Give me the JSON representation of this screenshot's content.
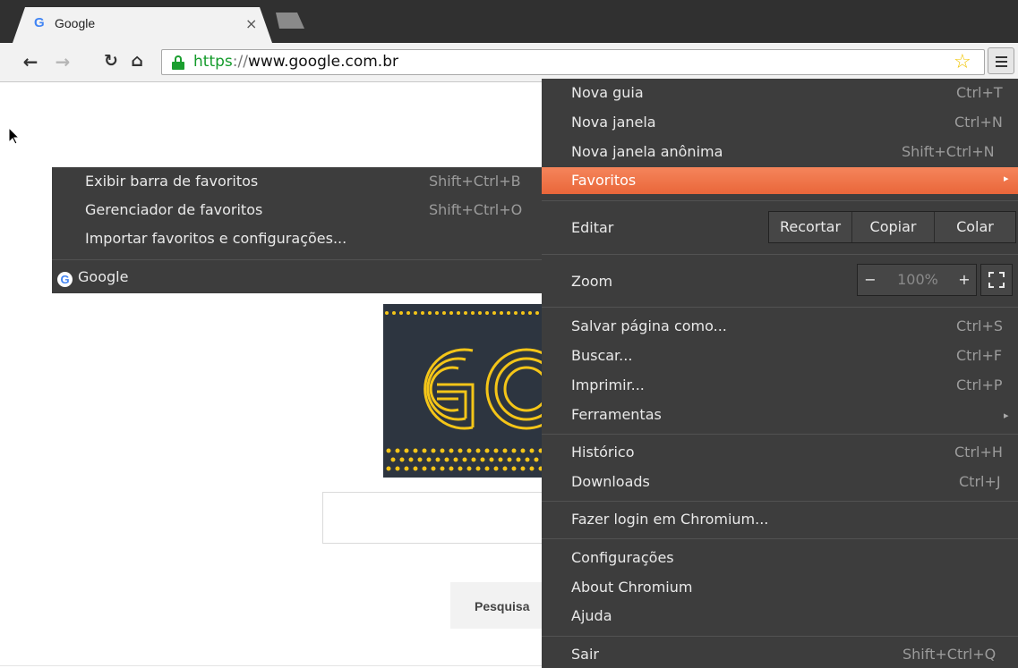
{
  "browser": {
    "tab": {
      "title": "Google",
      "close": "×"
    },
    "url": {
      "scheme": "https",
      "separator": "://",
      "host": "www.google.com.br"
    }
  },
  "page": {
    "search_button": "Pesquisa"
  },
  "main_menu": {
    "items": [
      {
        "label": "Nova guia",
        "shortcut": "Ctrl+T"
      },
      {
        "label": "Nova janela",
        "shortcut": "Ctrl+N"
      },
      {
        "label": "Nova janela anônima",
        "shortcut": "Shift+Ctrl+N"
      }
    ],
    "favoritos": {
      "label": "Favoritos",
      "arrow": "▸"
    },
    "edit": {
      "label": "Editar",
      "cut": "Recortar",
      "copy": "Copiar",
      "paste": "Colar"
    },
    "zoom": {
      "label": "Zoom",
      "minus": "−",
      "value": "100%",
      "plus": "+"
    },
    "items2": [
      {
        "label": "Salvar página como...",
        "shortcut": "Ctrl+S"
      },
      {
        "label": "Buscar...",
        "shortcut": "Ctrl+F"
      },
      {
        "label": "Imprimir...",
        "shortcut": "Ctrl+P"
      }
    ],
    "tools": {
      "label": "Ferramentas",
      "arrow": "▸"
    },
    "items3": [
      {
        "label": "Histórico",
        "shortcut": "Ctrl+H"
      },
      {
        "label": "Downloads",
        "shortcut": "Ctrl+J"
      }
    ],
    "signin": {
      "label": "Fazer login em Chromium..."
    },
    "items4": [
      {
        "label": "Configurações"
      },
      {
        "label": "About Chromium"
      },
      {
        "label": "Ajuda"
      }
    ],
    "exit": {
      "label": "Sair",
      "shortcut": "Shift+Ctrl+Q"
    }
  },
  "bookmarks_menu": {
    "items": [
      {
        "label": "Exibir barra de favoritos",
        "shortcut": "Shift+Ctrl+B"
      },
      {
        "label": "Gerenciador de favoritos",
        "shortcut": "Shift+Ctrl+O"
      },
      {
        "label": "Importar favoritos e configurações..."
      }
    ],
    "bookmark": {
      "label": "Google"
    }
  },
  "colors": {
    "menu_bg": "#3d3d3d",
    "highlight": "#ee7040",
    "url_green": "#149b2b"
  }
}
